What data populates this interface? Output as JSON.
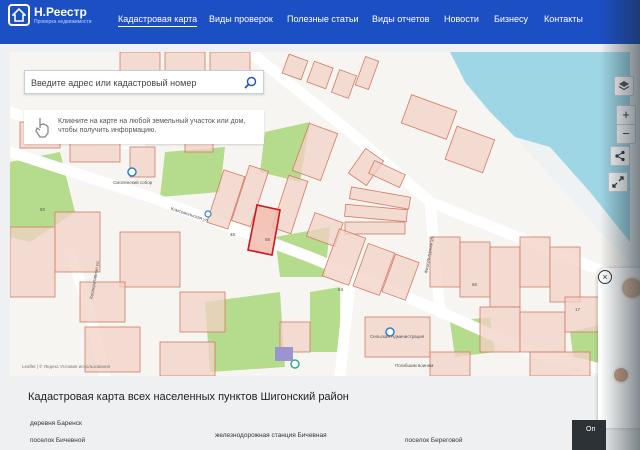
{
  "header": {
    "brand": "Н.Реестр",
    "tagline": "Проверка недвижимости",
    "nav": [
      {
        "label": "Кадастровая карта",
        "active": true
      },
      {
        "label": "Виды проверок"
      },
      {
        "label": "Полезные статьи"
      },
      {
        "label": "Виды отчетов"
      },
      {
        "label": "Новости"
      },
      {
        "label": "Бизнесу"
      },
      {
        "label": "Контакты"
      }
    ]
  },
  "map": {
    "search_placeholder": "Введите адрес или кадастровый номер",
    "hint": "Кликните на карте на любой земельный участок или дом, чтобы получить информацию.",
    "controls": [
      "+",
      "−"
    ],
    "attribution": "Leaflet | © Яндекс   Условия использования",
    "labels": {
      "street_komsomol": "Комсомольская ул.",
      "street_fizkult": "Физкультурная ул.",
      "street_kooperat": "Кооперативная ул.",
      "church": "Смоленский собор",
      "admin": "Сельская Администрация",
      "memorial": "Погибшим воинам",
      "n1": "50",
      "n2": "48",
      "n3": "58",
      "n4": "66",
      "n5": "64",
      "n6": "17"
    },
    "colors": {
      "parcel_fill": "#f3d2c6",
      "parcel_stroke": "#d37a63",
      "selected_stroke": "#d0141e",
      "green": "#b5dc8d",
      "water": "#9fd6e5",
      "road": "#ffffff"
    }
  },
  "content": {
    "title": "Кадастровая карта всех населенных пунктов Шигонский район",
    "links": [
      "деревня Баренск",
      "железнодорожная станция Бичевная",
      "поселок Бичевной",
      "поселок Береговой"
    ],
    "button": "Оп"
  }
}
